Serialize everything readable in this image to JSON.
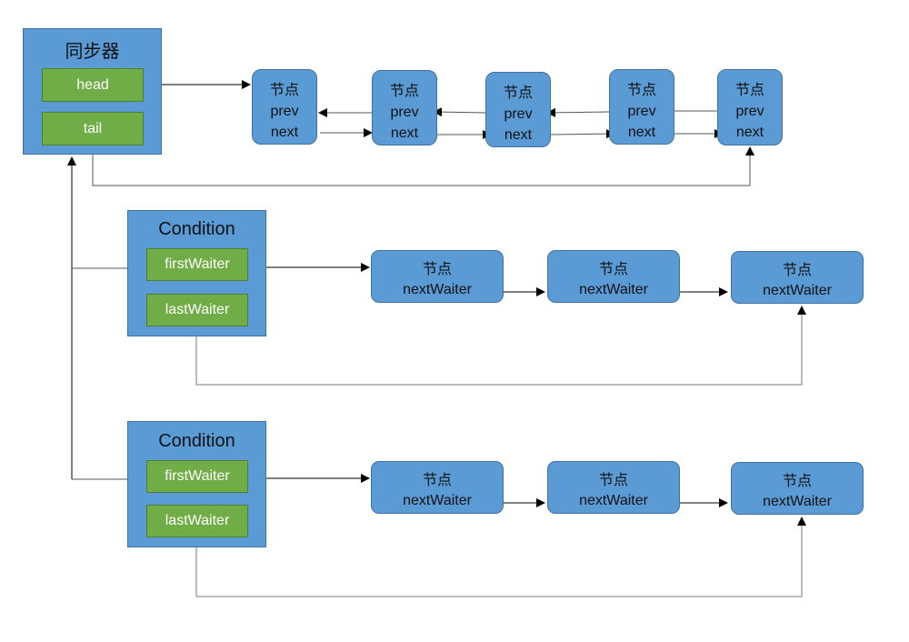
{
  "sync": {
    "title": "同步器",
    "fields": {
      "head": "head",
      "tail": "tail"
    }
  },
  "sync_queue": {
    "nodes": [
      {
        "title": "节点",
        "prev": "prev",
        "next": "next"
      },
      {
        "title": "节点",
        "prev": "prev",
        "next": "next"
      },
      {
        "title": "节点",
        "prev": "prev",
        "next": "next"
      },
      {
        "title": "节点",
        "prev": "prev",
        "next": "next"
      },
      {
        "title": "节点",
        "prev": "prev",
        "next": "next"
      }
    ]
  },
  "conditions": [
    {
      "title": "Condition",
      "first": "firstWaiter",
      "last": "lastWaiter",
      "nodes": [
        {
          "title": "节点",
          "field": "nextWaiter"
        },
        {
          "title": "节点",
          "field": "nextWaiter"
        },
        {
          "title": "节点",
          "field": "nextWaiter"
        }
      ]
    },
    {
      "title": "Condition",
      "first": "firstWaiter",
      "last": "lastWaiter",
      "nodes": [
        {
          "title": "节点",
          "field": "nextWaiter"
        },
        {
          "title": "节点",
          "field": "nextWaiter"
        },
        {
          "title": "节点",
          "field": "nextWaiter"
        }
      ]
    }
  ],
  "colors": {
    "container": "#5b9bd5",
    "field": "#70ad47",
    "line": "#000000"
  }
}
